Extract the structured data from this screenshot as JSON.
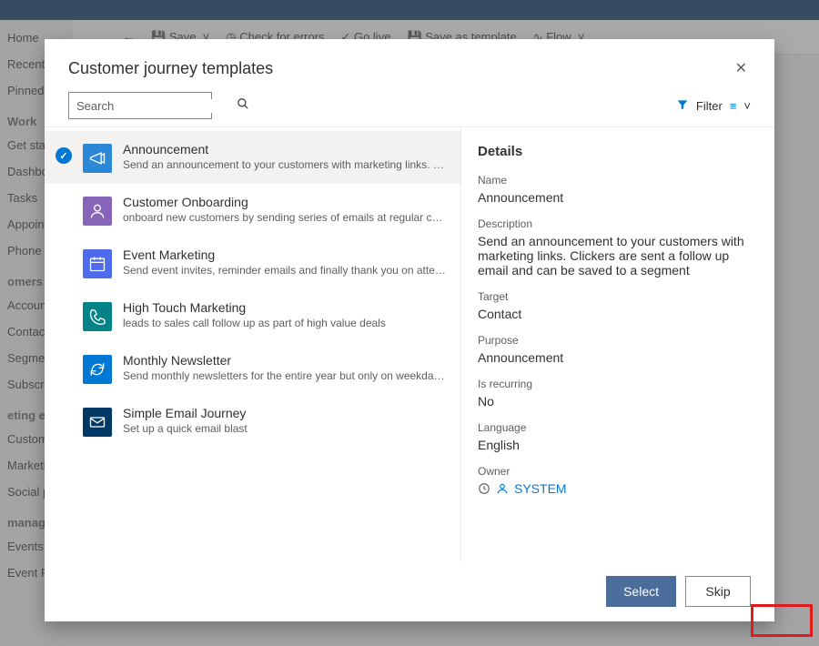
{
  "bgCommand": {
    "save": "Save",
    "check": "Check for errors",
    "golive": "Go live",
    "saveas": "Save as template",
    "flow": "Flow"
  },
  "bgNav": {
    "g0": [
      "Home",
      "Recent",
      "Pinned"
    ],
    "h1": "Work",
    "g1": [
      "Get start",
      "Dashboa",
      "Tasks",
      "Appoint",
      "Phone C"
    ],
    "h2": "omers",
    "g2": [
      "Account",
      "Contacts",
      "Segmen",
      "Subscrip"
    ],
    "h3": "eting ex",
    "g3": [
      "Custome",
      "Marketin",
      "Social po"
    ],
    "h4": "manag",
    "g4": [
      "Events",
      "Event Registrations"
    ]
  },
  "modal": {
    "title": "Customer journey templates",
    "searchPlaceholder": "Search",
    "filter": "Filter"
  },
  "templates": [
    {
      "name": "Announcement",
      "desc": "Send an announcement to your customers with marketing links. Clickers are sent a…",
      "color": "#2b88d8",
      "icon": "megaphone",
      "selected": true
    },
    {
      "name": "Customer Onboarding",
      "desc": "onboard new customers by sending series of emails at regular cadence",
      "color": "#8764b8",
      "icon": "person"
    },
    {
      "name": "Event Marketing",
      "desc": "Send event invites, reminder emails and finally thank you on attending",
      "color": "#4f6bed",
      "icon": "calendar"
    },
    {
      "name": "High Touch Marketing",
      "desc": "leads to sales call follow up as part of high value deals",
      "color": "#038387",
      "icon": "phone"
    },
    {
      "name": "Monthly Newsletter",
      "desc": "Send monthly newsletters for the entire year but only on weekday afternoons",
      "color": "#0078d4",
      "icon": "refresh"
    },
    {
      "name": "Simple Email Journey",
      "desc": "Set up a quick email blast",
      "color": "#003966",
      "icon": "mail"
    }
  ],
  "details": {
    "heading": "Details",
    "nameLbl": "Name",
    "name": "Announcement",
    "descLbl": "Description",
    "desc": "Send an announcement to your customers with marketing links. Clickers are sent a follow up email and can be saved to a segment",
    "targetLbl": "Target",
    "target": "Contact",
    "purposeLbl": "Purpose",
    "purpose": "Announcement",
    "recurLbl": "Is recurring",
    "recur": "No",
    "langLbl": "Language",
    "lang": "English",
    "ownerLbl": "Owner",
    "owner": "SYSTEM"
  },
  "buttons": {
    "select": "Select",
    "skip": "Skip"
  }
}
